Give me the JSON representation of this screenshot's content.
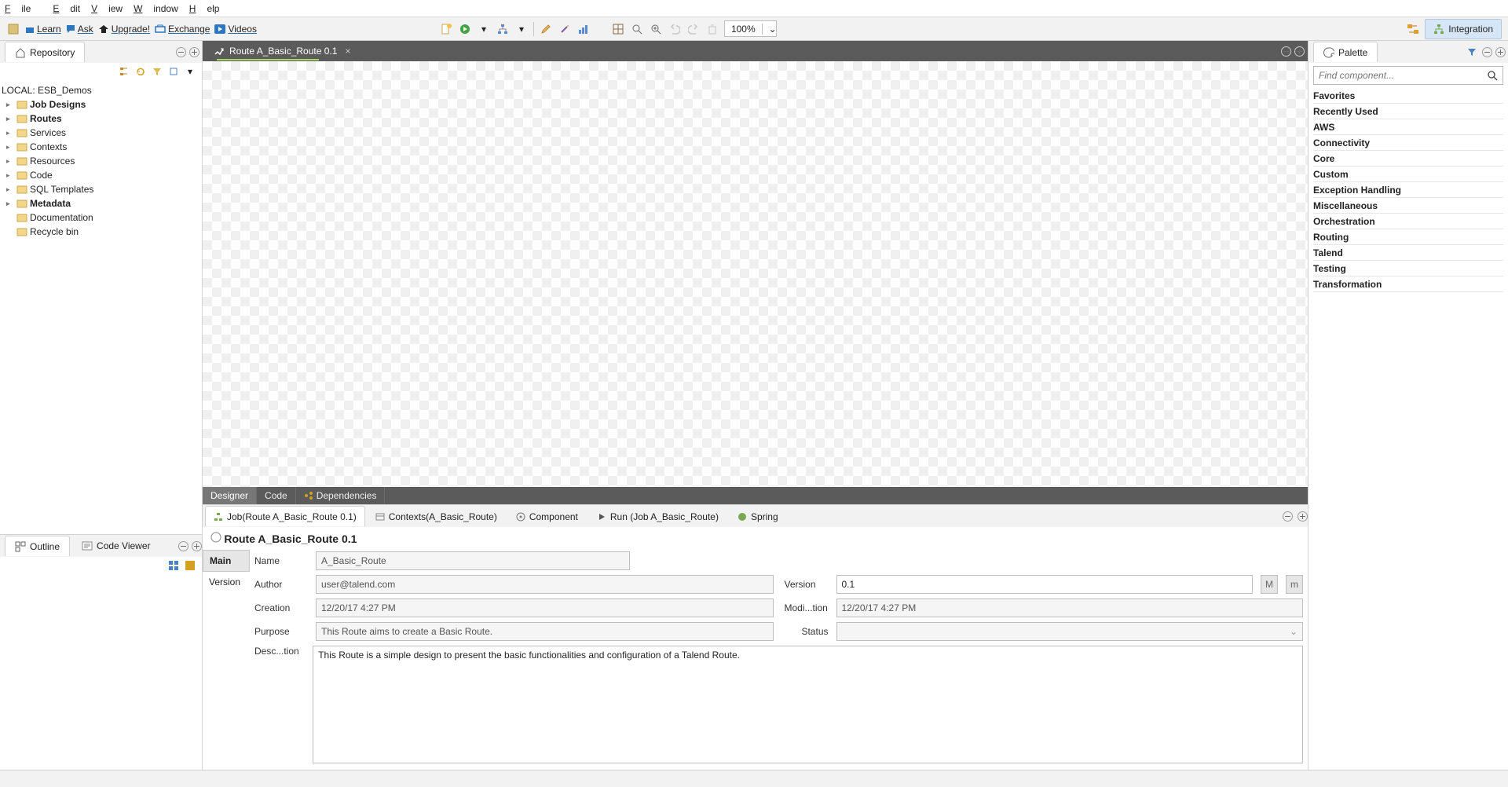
{
  "menubar": [
    "File",
    "Edit",
    "View",
    "Window",
    "Help"
  ],
  "toolbar_links": [
    {
      "label": "Learn"
    },
    {
      "label": "Ask"
    },
    {
      "label": "Upgrade!"
    },
    {
      "label": "Exchange"
    },
    {
      "label": "Videos"
    }
  ],
  "zoom": "100%",
  "perspective": "Integration",
  "repository": {
    "title": "Repository",
    "root": "LOCAL: ESB_Demos",
    "items": [
      {
        "label": "Job Designs",
        "bold": true
      },
      {
        "label": "Routes",
        "bold": true,
        "selected": true
      },
      {
        "label": "Services"
      },
      {
        "label": "Contexts"
      },
      {
        "label": "Resources"
      },
      {
        "label": "Code"
      },
      {
        "label": "SQL Templates"
      },
      {
        "label": "Metadata",
        "bold": true
      },
      {
        "label": "Documentation",
        "noexp": true
      },
      {
        "label": "Recycle bin",
        "noexp": true
      }
    ]
  },
  "outline": {
    "tab1": "Outline",
    "tab2": "Code Viewer"
  },
  "editor": {
    "tab": "Route A_Basic_Route 0.1",
    "bottom_tabs": [
      "Designer",
      "Code",
      "Dependencies"
    ]
  },
  "props": {
    "tabs": [
      "Job(Route A_Basic_Route 0.1)",
      "Contexts(A_Basic_Route)",
      "Component",
      "Run (Job A_Basic_Route)",
      "Spring"
    ],
    "title": "Route A_Basic_Route 0.1",
    "side": [
      "Main",
      "Version"
    ],
    "labels": {
      "name": "Name",
      "author": "Author",
      "creation": "Creation",
      "modification": "Modi...tion",
      "purpose": "Purpose",
      "version": "Version",
      "status": "Status",
      "description": "Desc...tion"
    },
    "values": {
      "name": "A_Basic_Route",
      "author": "user@talend.com",
      "creation": "12/20/17 4:27 PM",
      "modification": "12/20/17 4:27 PM",
      "purpose": "This Route aims to create a Basic Route.",
      "version": "0.1",
      "status": "",
      "description": "This Route is a simple design to present the basic functionalities and configuration of a Talend Route."
    },
    "vbtn_M": "M",
    "vbtn_m": "m"
  },
  "palette": {
    "title": "Palette",
    "search_placeholder": "Find component...",
    "items": [
      "Favorites",
      "Recently Used",
      "AWS",
      "Connectivity",
      "Core",
      "Custom",
      "Exception Handling",
      "Miscellaneous",
      "Orchestration",
      "Routing",
      "Talend",
      "Testing",
      "Transformation"
    ]
  }
}
